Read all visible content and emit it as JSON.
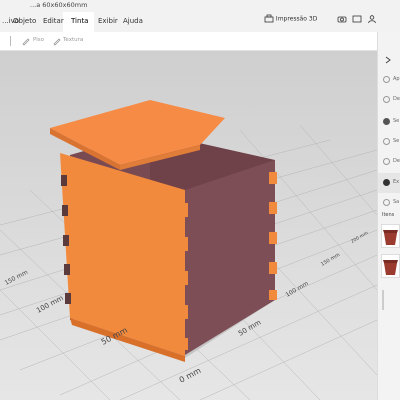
{
  "window": {
    "title": "...a 60x60x60mm"
  },
  "menu": {
    "items": [
      "...ivo",
      "Objeto",
      "Editar",
      "Tinta",
      "Exibir",
      "Ajuda"
    ],
    "active": "Tinta"
  },
  "right_tools": {
    "print3d_label": "Impressão 3D"
  },
  "toolbar": {
    "paint_label": "Piso",
    "texture_label": "Textura"
  },
  "grid_labels": {
    "left_axis": [
      "0 mm",
      "50 mm",
      "100 mm",
      "150 mm"
    ],
    "right_axis": [
      "50 mm",
      "100 mm",
      "150 mm",
      "200 mm"
    ]
  },
  "panel": {
    "rows": [
      {
        "label": "Ap"
      },
      {
        "label": "De"
      },
      {
        "label": "Se"
      },
      {
        "label": "Se"
      },
      {
        "label": "De"
      },
      {
        "label": "Ex"
      },
      {
        "label": "Sa"
      }
    ],
    "items_label": "Itens"
  },
  "colors": {
    "box_front": "#f28a3e",
    "box_lid": "#f58b45",
    "box_inner": "#7d4e55",
    "panel_swatch": "#9b3a2e"
  }
}
